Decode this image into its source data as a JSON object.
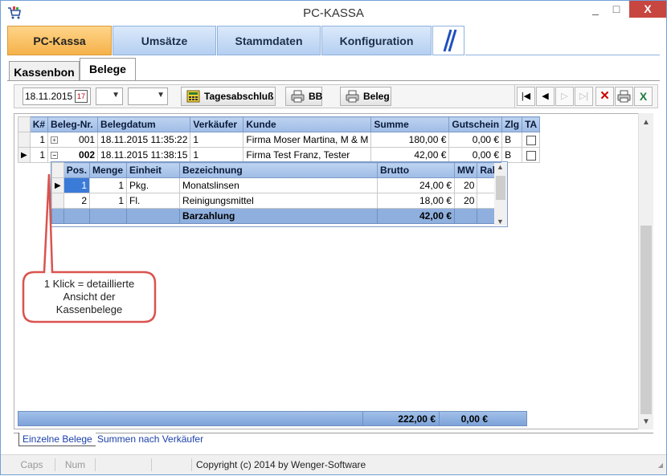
{
  "window": {
    "title": "PC-KASSA",
    "min": "_",
    "max": "□",
    "close": "X"
  },
  "nav": {
    "tabs": [
      "PC-Kassa",
      "Umsätze",
      "Stammdaten",
      "Konfiguration"
    ],
    "active": "PC-Kassa"
  },
  "subtabs": {
    "kassenbon": "Kassenbon",
    "belege": "Belege"
  },
  "toolbar": {
    "date": "18.11.2015",
    "tagesabschluss": "Tagesabschluß",
    "bb": "BB",
    "beleg": "Beleg"
  },
  "table": {
    "headers": [
      "K#",
      "Beleg-Nr.",
      "Belegdatum",
      "Verkäufer",
      "Kunde",
      "Summe",
      "Gutschein",
      "Zlg",
      "TA"
    ],
    "rows": [
      {
        "k": "1",
        "expander": "+",
        "nr": "001",
        "datum": "18.11.2015 11:35:22",
        "verkaeufer": "1",
        "kunde": "Firma Moser Martina,  M & M",
        "summe": "180,00 €",
        "gutschein": "0,00 €",
        "zlg": "B"
      },
      {
        "k": "1",
        "expander": "−",
        "nr": "002",
        "datum": "18.11.2015 11:38:15",
        "verkaeufer": "1",
        "kunde": "Firma Test Franz,  Tester",
        "summe": "42,00 €",
        "gutschein": "0,00 €",
        "zlg": "B"
      }
    ]
  },
  "detail": {
    "headers": [
      "Pos.",
      "Menge",
      "Einheit",
      "Bezeichnung",
      "Brutto",
      "MW",
      "Rab"
    ],
    "rows": [
      {
        "pos": "1",
        "menge": "1",
        "einheit": "Pkg.",
        "bez": "Monatslinsen",
        "brutto": "24,00 €",
        "mw": "20"
      },
      {
        "pos": "2",
        "menge": "1",
        "einheit": "Fl.",
        "bez": "Reinigungsmittel",
        "brutto": "18,00 €",
        "mw": "20"
      }
    ],
    "footer": {
      "label": "Barzahlung",
      "total": "42,00 €"
    }
  },
  "callout": {
    "text": "1 Klick  =  detaillierte Ansicht der Kassenbelege"
  },
  "summary": {
    "total": "222,00 €",
    "gutschein": "0,00 €"
  },
  "bottomtabs": [
    "Einzelne Belege",
    "Summen nach Verkäufer"
  ],
  "status": {
    "caps": "Caps",
    "num": "Num",
    "copyright": "Copyright (c) 2014 by Wenger-Software"
  },
  "colors": {
    "accent": "#f5b24a",
    "header_blue": "#9fbce6",
    "close_red": "#c7463f",
    "callout_red": "#d9534f"
  }
}
